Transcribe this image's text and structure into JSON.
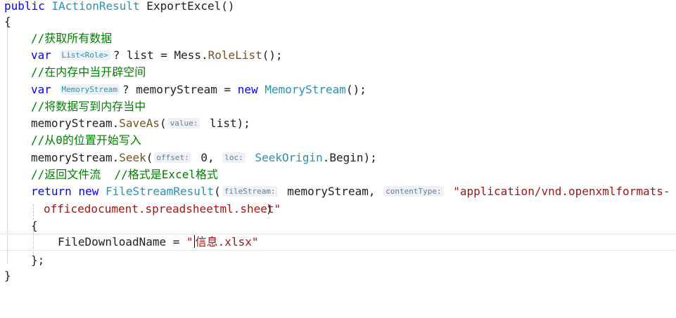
{
  "code": {
    "signature_kw": "public",
    "signature_type": "IActionResult",
    "signature_rest": " ExportExcel()",
    "open_brace": "{",
    "close_brace": "}",
    "comment_get_all": "//获取所有数据",
    "var_kw": "var",
    "list_hint": "List<Role>",
    "list_hint_suffix": "?",
    "list_rest_a": " list = Mess.",
    "list_method": "RoleList",
    "list_rest_b": "();",
    "comment_alloc": "//在内存中当开辟空间",
    "ms_hint": "MemoryStream",
    "ms_hint_suffix": "?",
    "ms_rest_a": " memoryStream = ",
    "new_kw": "new",
    "ms_type": " MemoryStream",
    "ms_rest_b": "();",
    "comment_write": "//将数据写到内存当中",
    "saveas_obj": "memoryStream.",
    "saveas_method": "SaveAs",
    "paren_open": "(",
    "value_hint": "value:",
    "saveas_rest": " list);",
    "comment_seek": "//从0的位置开始写入",
    "seek_obj": "memoryStream.",
    "seek_method": "Seek",
    "offset_hint": "offset:",
    "seek_arg1": " 0, ",
    "loc_hint": "loc:",
    "seek_type": " SeekOrigin",
    "seek_rest": ".Begin);",
    "comment_return": "//返回文件流  //格式是Excel格式",
    "return_kw": "return",
    "fsr_type": "FileStreamResult",
    "filestream_hint": "fileStream:",
    "return_arg1": " memoryStream, ",
    "contenttype_hint": "contentType:",
    "content_type_a": " \"application/vnd.openxmlformats-",
    "content_type_b": "officedocument.spreadsheetml.sheet\"",
    "inner_open_brace": "{",
    "filename_prop": "FileDownloadName = ",
    "filename_quote": "\"",
    "filename_value": "信息.xlsx\"",
    "inner_close_brace": "};"
  },
  "colors": {
    "keyword": "#0000ff",
    "type": "#2b91af",
    "comment": "#008000",
    "string": "#a31515",
    "method": "#74531f",
    "hint_bg": "#eef1f5"
  }
}
